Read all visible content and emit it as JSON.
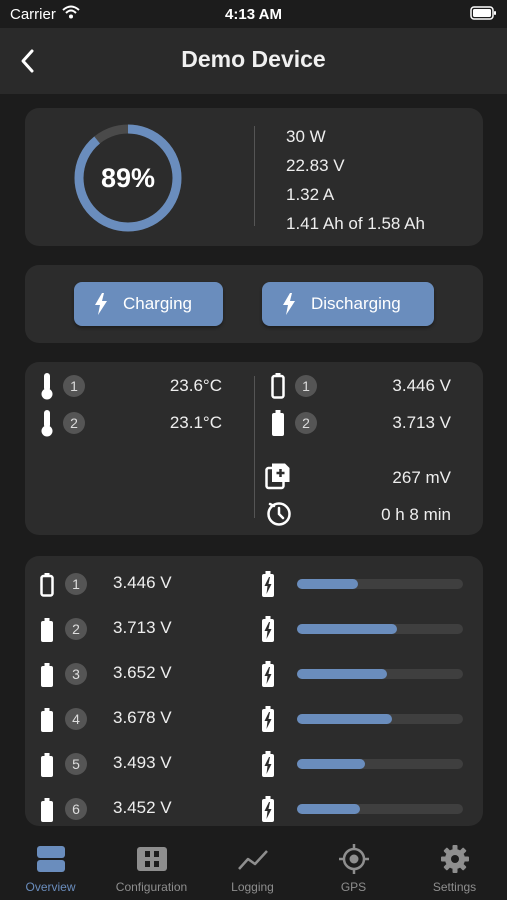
{
  "status_bar": {
    "carrier": "Carrier",
    "time": "4:13 AM"
  },
  "nav": {
    "title": "Demo Device",
    "back_icon": "chevron-left-icon"
  },
  "summary": {
    "percent_text": "89%",
    "percent_value": 0.89,
    "power": "30 W",
    "voltage": "22.83 V",
    "current": "1.32 A",
    "capacity": "1.41 Ah of 1.58 Ah"
  },
  "modes": {
    "charging_label": "Charging",
    "discharging_label": "Discharging"
  },
  "sensors": {
    "temps": [
      {
        "id": "1",
        "value": "23.6°C"
      },
      {
        "id": "2",
        "value": "23.1°C"
      }
    ],
    "batteries": [
      {
        "id": "1",
        "value": "3.446 V"
      },
      {
        "id": "2",
        "value": "3.713 V"
      }
    ],
    "delta": "267 mV",
    "time": "0 h 8 min"
  },
  "cells": [
    {
      "id": "1",
      "voltage": "3.446 V",
      "level": 0.37
    },
    {
      "id": "2",
      "voltage": "3.713 V",
      "level": 0.6
    },
    {
      "id": "3",
      "voltage": "3.652 V",
      "level": 0.54
    },
    {
      "id": "4",
      "voltage": "3.678 V",
      "level": 0.57
    },
    {
      "id": "5",
      "voltage": "3.493 V",
      "level": 0.41
    },
    {
      "id": "6",
      "voltage": "3.452 V",
      "level": 0.38
    }
  ],
  "tabs": [
    {
      "label": "Overview",
      "icon": "overview-icon"
    },
    {
      "label": "Configuration",
      "icon": "configuration-icon"
    },
    {
      "label": "Logging",
      "icon": "chart-line-icon"
    },
    {
      "label": "GPS",
      "icon": "gps-icon"
    },
    {
      "label": "Settings",
      "icon": "gear-icon"
    }
  ],
  "colors": {
    "accent": "#6a8dbd",
    "card": "#2c2c2c",
    "background": "#1c1c1c"
  }
}
